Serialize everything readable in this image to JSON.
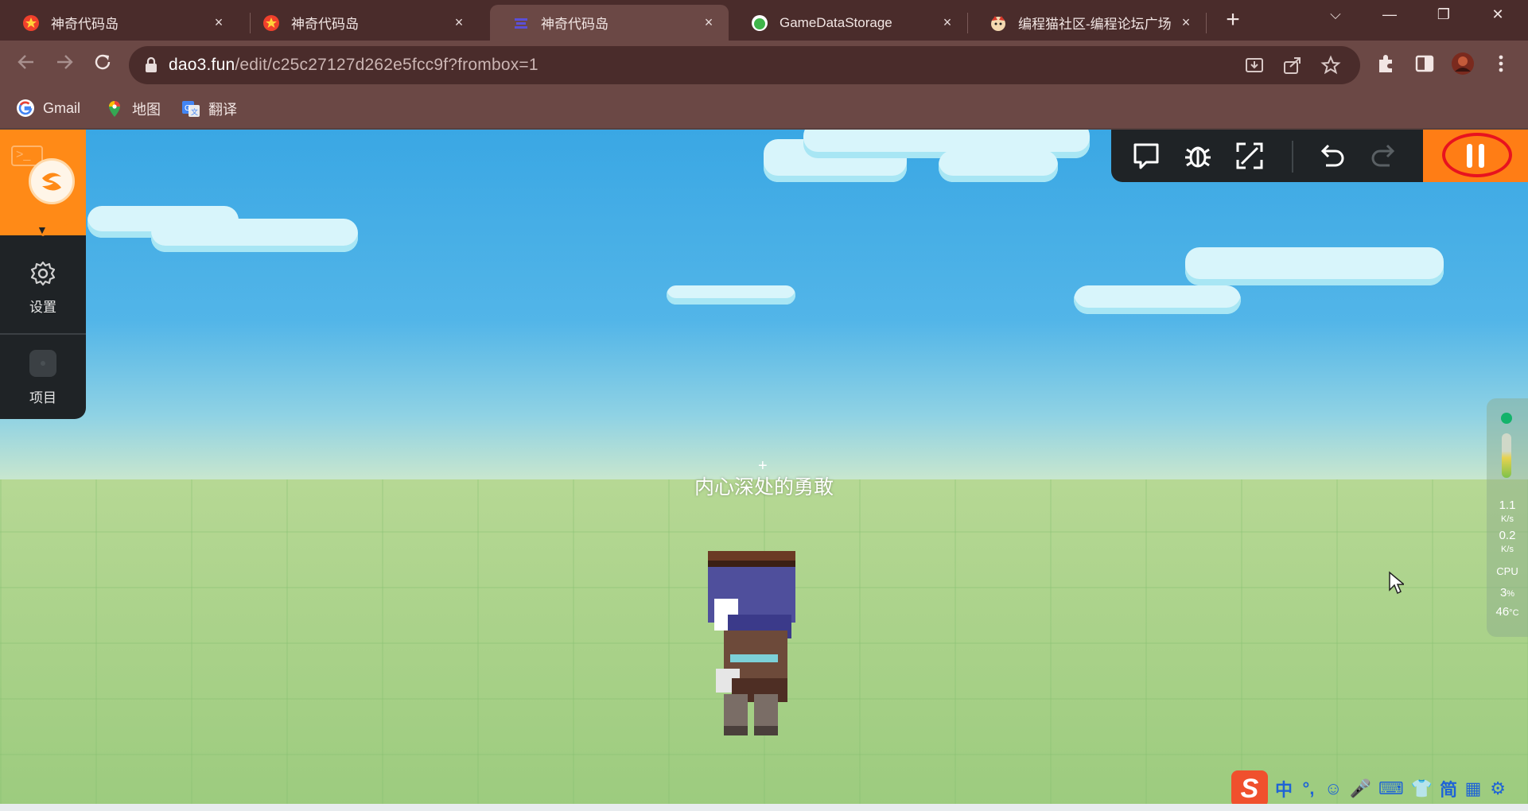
{
  "browser": {
    "tabs": [
      {
        "title": "神奇代码岛",
        "close": "×",
        "active": false,
        "favicon": "star-red"
      },
      {
        "title": "神奇代码岛",
        "close": "×",
        "active": false,
        "favicon": "star-red"
      },
      {
        "title": "神奇代码岛",
        "close": "×",
        "active": true,
        "favicon": "dao-purple"
      },
      {
        "title": "GameDataStorage",
        "close": "×",
        "active": false,
        "favicon": "green-blob"
      },
      {
        "title": "编程猫社区-编程论坛广场",
        "close": "×",
        "active": false,
        "favicon": "codemao"
      }
    ],
    "new_tab": "+",
    "window_controls": {
      "dropdown": "⌵",
      "minimize": "—",
      "restore": "❐",
      "close": "✕"
    },
    "url_host": "dao3.fun",
    "url_rest": "/edit/c25c27127d262e5fcc9f?frombox=1",
    "bookmarks": [
      {
        "label": "Gmail",
        "icon": "google-icon"
      },
      {
        "label": "地图",
        "icon": "maps-icon"
      },
      {
        "label": "翻译",
        "icon": "translate-icon"
      }
    ]
  },
  "editor": {
    "left_panel": {
      "console_glyph": ">_",
      "items": [
        {
          "label": "设置",
          "icon": "gear-icon"
        },
        {
          "label": "项目",
          "icon": "project-icon"
        }
      ]
    },
    "toolbar": {
      "buttons": [
        "chat-icon",
        "bug-icon",
        "expand-icon",
        "undo-icon",
        "redo-icon"
      ],
      "pause": "pause-icon"
    },
    "player_name": "内心深处的勇敢",
    "crosshair": "+",
    "meter": {
      "status_color": "#13b36b",
      "upload": {
        "value": "1.1",
        "unit": "K/s"
      },
      "download": {
        "value": "0.2",
        "unit": "K/s"
      },
      "cpu_label": "CPU",
      "cpu_percent": {
        "value": "3",
        "unit": "%"
      },
      "temperature": {
        "value": "46",
        "unit": "°C"
      }
    }
  },
  "ime": {
    "items": [
      "中",
      "°,",
      "☺",
      "🎤",
      "⌨",
      "👕",
      "简",
      "▦",
      "⚙"
    ]
  },
  "colors": {
    "chrome_dark": "#4a2c2b",
    "chrome": "#6b4845",
    "accent_orange": "#ff8a17",
    "panel_dark": "#1f2326",
    "highlight_red": "#e8131f"
  }
}
